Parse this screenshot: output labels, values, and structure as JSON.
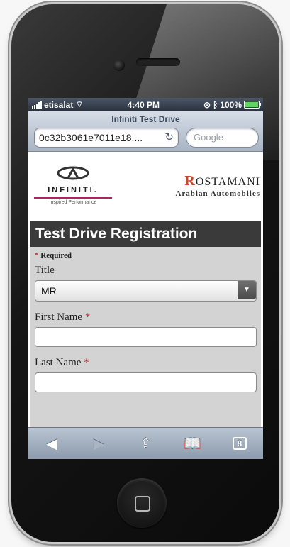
{
  "status_bar": {
    "carrier": "etisalat",
    "time": "4:40 PM",
    "battery": "100%"
  },
  "browser": {
    "page_title": "Infiniti Test Drive",
    "address": "0c32b3061e7011e18....",
    "search_placeholder": "Google"
  },
  "logos": {
    "infiniti_word": "INFINITI.",
    "infiniti_tagline": "Inspired Performance",
    "partner_brand_initial": "R",
    "partner_brand": "OSTAMANI",
    "partner_sub": "Arabian Automobiles"
  },
  "form": {
    "header": "Test Drive Registration",
    "required_note": "Required",
    "required_mark": "*",
    "fields": {
      "title_label": "Title",
      "title_value": "MR",
      "first_name_label": "First Name",
      "last_name_label": "Last Name"
    }
  },
  "toolbar": {
    "tab_count": "8"
  },
  "icons": [
    "wifi-icon",
    "bluetooth-icon",
    "battery-icon",
    "reload-icon",
    "back-icon",
    "forward-icon",
    "share-icon",
    "bookmarks-icon",
    "tabs-icon",
    "home-button"
  ],
  "colors": {
    "header_bg": "#3a3a3a",
    "form_bg": "#d3d3d3",
    "required_star": "#c62828",
    "brand_accent": "#b3206d"
  }
}
